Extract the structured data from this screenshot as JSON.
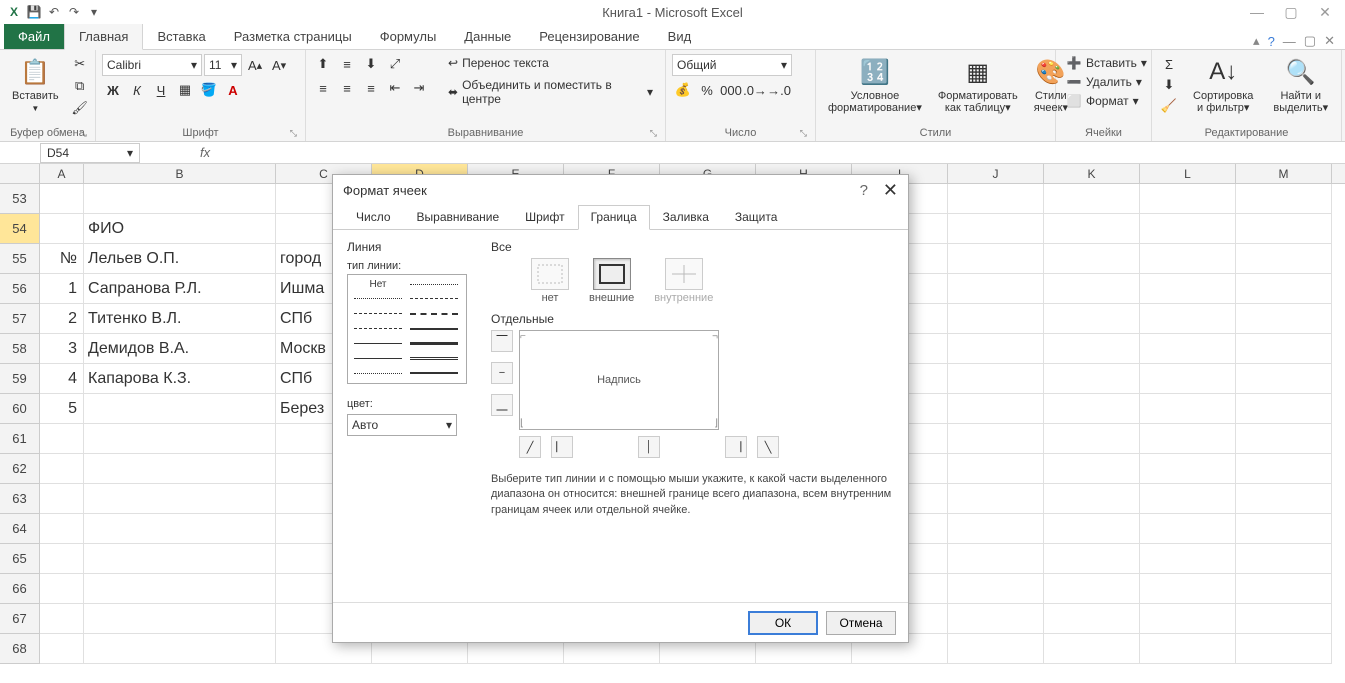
{
  "title": "Книга1 - Microsoft Excel",
  "qat": {
    "save": "💾",
    "undo": "↶",
    "redo": "↷"
  },
  "tabs": {
    "file": "Файл",
    "items": [
      "Главная",
      "Вставка",
      "Разметка страницы",
      "Формулы",
      "Данные",
      "Рецензирование",
      "Вид"
    ],
    "active": 0
  },
  "ribbon": {
    "clipboard": {
      "paste": "Вставить",
      "label": "Буфер обмена"
    },
    "font": {
      "name": "Calibri",
      "size": "11",
      "label": "Шрифт"
    },
    "alignment": {
      "wrap": "Перенос текста",
      "merge": "Объединить и поместить в центре",
      "label": "Выравнивание"
    },
    "number": {
      "format": "Общий",
      "label": "Число"
    },
    "styles": {
      "cond": "Условное форматирование",
      "table": "Форматировать как таблицу",
      "cell": "Стили ячеек",
      "label": "Стили"
    },
    "cells": {
      "insert": "Вставить",
      "delete": "Удалить",
      "format": "Формат",
      "label": "Ячейки"
    },
    "editing": {
      "sort": "Сортировка и фильтр",
      "find": "Найти и выделить",
      "label": "Редактирование"
    }
  },
  "namebox": "D54",
  "columns": [
    "A",
    "B",
    "C",
    "D",
    "E",
    "F",
    "G",
    "H",
    "I",
    "J",
    "K",
    "L",
    "M"
  ],
  "rows": [
    {
      "n": "53",
      "a": "",
      "b": "",
      "c": ""
    },
    {
      "n": "54",
      "a": "",
      "b": "ФИО",
      "c": ""
    },
    {
      "n": "55",
      "a": "№",
      "b": "Лельев О.П.",
      "c": "город"
    },
    {
      "n": "56",
      "a": "1",
      "b": "Сапранова Р.Л.",
      "c": "Ишма"
    },
    {
      "n": "57",
      "a": "2",
      "b": "Титенко В.Л.",
      "c": "СПб"
    },
    {
      "n": "58",
      "a": "3",
      "b": "Демидов В.А.",
      "c": "Москв"
    },
    {
      "n": "59",
      "a": "4",
      "b": "Капарова К.З.",
      "c": "СПб"
    },
    {
      "n": "60",
      "a": "5",
      "b": "",
      "c": "Берез"
    },
    {
      "n": "61",
      "a": "",
      "b": "",
      "c": ""
    },
    {
      "n": "62",
      "a": "",
      "b": "",
      "c": ""
    },
    {
      "n": "63",
      "a": "",
      "b": "",
      "c": ""
    },
    {
      "n": "64",
      "a": "",
      "b": "",
      "c": ""
    },
    {
      "n": "65",
      "a": "",
      "b": "",
      "c": ""
    },
    {
      "n": "66",
      "a": "",
      "b": "",
      "c": ""
    },
    {
      "n": "67",
      "a": "",
      "b": "",
      "c": ""
    },
    {
      "n": "68",
      "a": "",
      "b": "",
      "c": ""
    }
  ],
  "dialog": {
    "title": "Формат ячеек",
    "tabs": [
      "Число",
      "Выравнивание",
      "Шрифт",
      "Граница",
      "Заливка",
      "Защита"
    ],
    "activeTab": 3,
    "line": {
      "group": "Линия",
      "typeLabel": "тип линии:",
      "none": "Нет",
      "colorLabel": "цвет:",
      "colorValue": "Авто"
    },
    "all": {
      "group": "Все",
      "none": "нет",
      "outline": "внешние",
      "inside": "внутренние"
    },
    "individual": "Отдельные",
    "previewLabel": "Надпись",
    "hint": "Выберите тип линии и с помощью мыши укажите, к какой части выделенного диапазона он относится: внешней границе всего диапазона, всем внутренним границам ячеек или отдельной ячейке.",
    "ok": "ОК",
    "cancel": "Отмена"
  }
}
